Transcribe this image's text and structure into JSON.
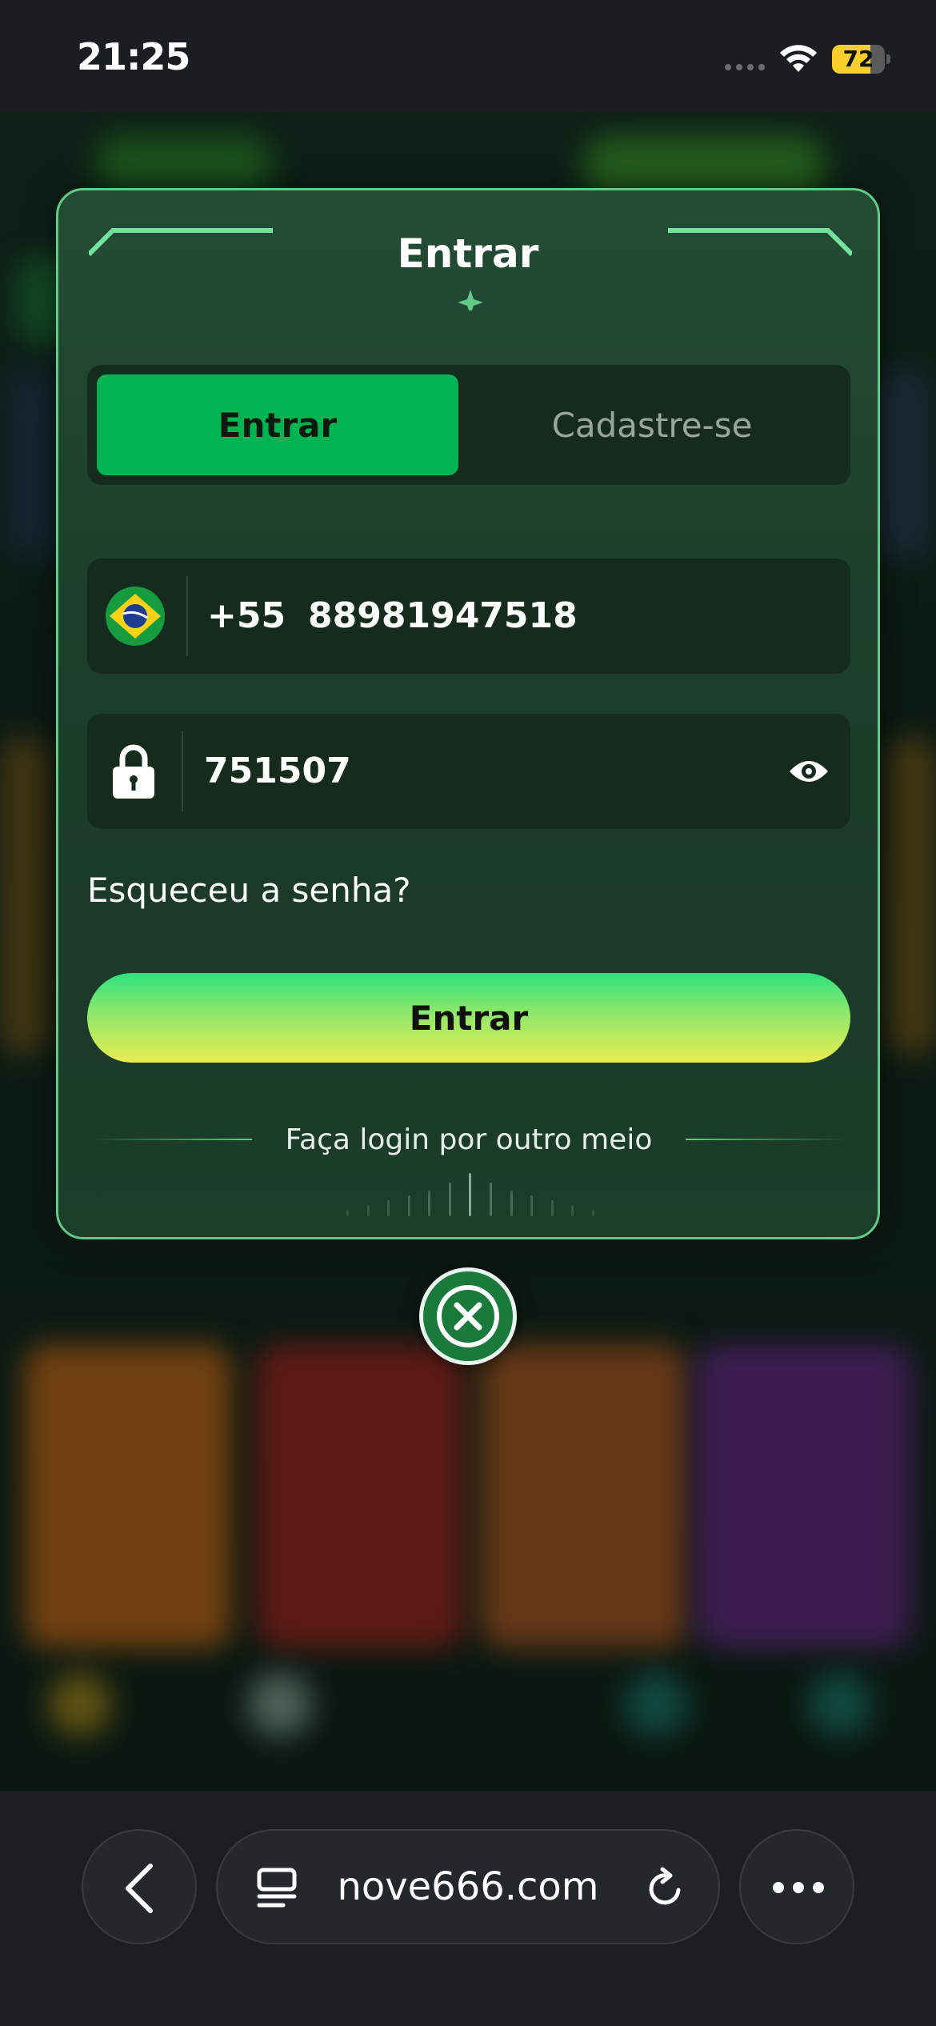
{
  "status_bar": {
    "time": "21:25",
    "battery_level": "72",
    "battery_fraction": 0.72,
    "icons": [
      "cellular-dots-icon",
      "wifi-icon",
      "battery-icon"
    ]
  },
  "login_modal": {
    "title": "Entrar",
    "tabs": [
      {
        "label": "Entrar",
        "selected": true
      },
      {
        "label": "Cadastre-se",
        "selected": false
      }
    ],
    "phone_field": {
      "country_flag": "brazil-flag-icon",
      "dial_code": "+55",
      "value": "88981947518"
    },
    "password_field": {
      "icon": "lock-icon",
      "value": "751507",
      "visibility_icon": "eye-icon"
    },
    "forgot_password": "Esqueceu a senha?",
    "submit_label": "Entrar",
    "alt_login_text": "Faça login por outro meio",
    "colors": {
      "border": "#62c987",
      "tab_active": "#00b451",
      "button_gradient_top": "#2de27e",
      "button_gradient_bottom": "#e9ec52"
    }
  },
  "close_button": {
    "icon": "close-icon"
  },
  "browser_toolbar": {
    "url": "nove666.com",
    "icons": [
      "back-icon",
      "reader-mode-icon",
      "reload-icon",
      "more-icon"
    ]
  }
}
